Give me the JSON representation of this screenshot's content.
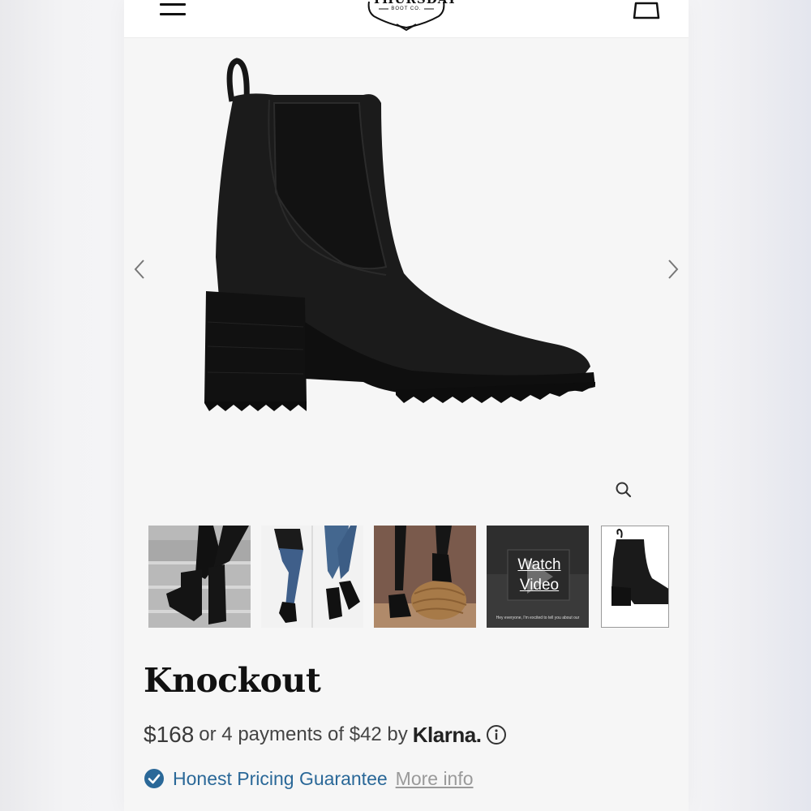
{
  "header": {
    "logo_top": "THURSDAY",
    "logo_sub": "BOOT CO.",
    "menu_icon": "hamburger-menu-icon",
    "cart_icon": "shopping-bag-icon"
  },
  "gallery": {
    "prev_icon": "chevron-left-icon",
    "next_icon": "chevron-right-icon",
    "zoom_icon": "magnifier-icon",
    "thumbnails": [
      {
        "kind": "image",
        "name": "thumbnail-stairs"
      },
      {
        "kind": "image",
        "name": "thumbnail-jeans"
      },
      {
        "kind": "image",
        "name": "thumbnail-pouf"
      },
      {
        "kind": "video",
        "name": "thumbnail-video",
        "label": "Watch Video",
        "caption": "Hey everyone, I'm excited to tell you about our"
      },
      {
        "kind": "image",
        "name": "thumbnail-side-view",
        "selected": true
      }
    ],
    "watch_label_1": "Watch",
    "watch_label_2": "Video",
    "video_caption": "Hey everyone, I'm excited to tell you about our"
  },
  "product": {
    "title": "Knockout",
    "price": "$168",
    "installments_text": "or 4 payments of $42 by",
    "klarna_label": "Klarna.",
    "guarantee_label": "Honest Pricing Guarantee",
    "more_info_label": "More info"
  },
  "colors": {
    "accent_blue": "#2a6898",
    "link_gray": "#9a9a9a",
    "page_bg": "#f6f6f6"
  }
}
